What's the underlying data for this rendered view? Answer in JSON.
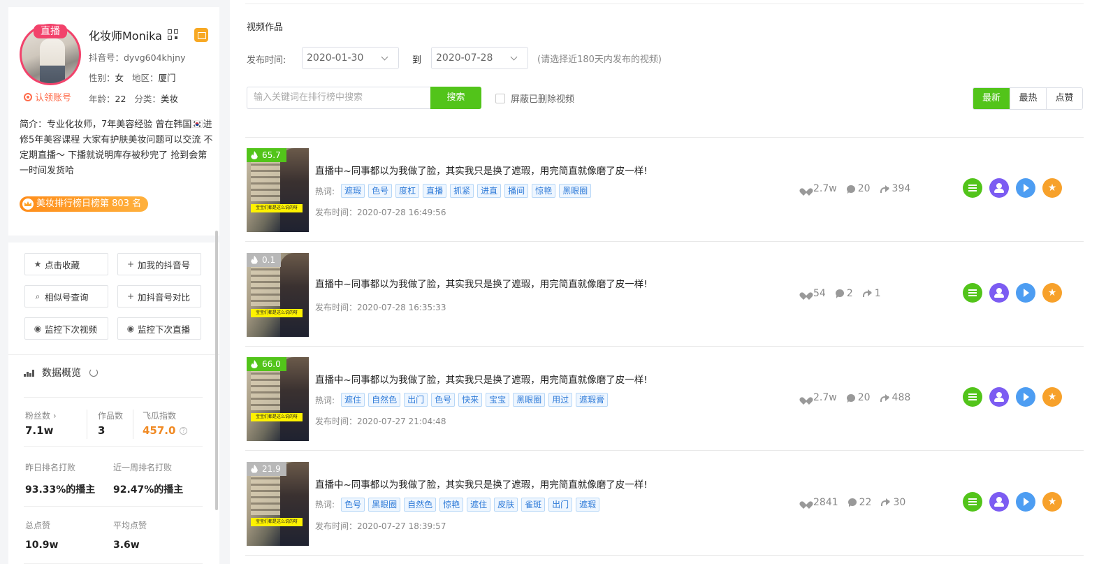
{
  "profile": {
    "live_badge": "直播",
    "name": "化妆师Monika",
    "douyin_id": "抖音号：dyvg604khjny",
    "gender_label": "性别：",
    "gender": "女",
    "region_label": "地区：",
    "region": "厦门",
    "age_label": "年龄：",
    "age": "22",
    "category_label": "分类：",
    "category": "美妆",
    "claim": "认领账号",
    "intro": "简介：专业化妆师，7年美容经验 曾在韩国🇰🇷进修5年美容课程 大家有护肤美妆问题可以交流 不定期直播～ 下播就说明库存被秒完了 抢到会第一时间发货哈",
    "rank": "美妆排行榜日榜第 803 名"
  },
  "actions": {
    "favorite": "点击收藏",
    "add_douyin": "加我的抖音号",
    "similar": "相似号查询",
    "add_compare": "加抖音号对比",
    "monitor_video": "监控下次视频",
    "monitor_live": "监控下次直播"
  },
  "overview": {
    "title": "数据概览",
    "fans_label": "粉丝数 ›",
    "fans": "7.1w",
    "works_label": "作品数",
    "works": "3",
    "feigua_label": "飞瓜指数",
    "feigua": "457.0",
    "yesterday_label": "昨日排名打败",
    "yesterday": "93.33%的播主",
    "week_label": "近一周排名打败",
    "week": "92.47%的播主",
    "likes_label": "总点赞",
    "likes": "10.9w",
    "avg_label": "平均点赞",
    "avg": "3.6w"
  },
  "videos_section": {
    "title": "视频作品",
    "publish_time_label": "发布时间:",
    "date_from": "2020-01-30",
    "to_label": "到",
    "date_to": "2020-07-28",
    "hint": "(请选择近180天内发布的视频)",
    "search_placeholder": "输入关键词在排行榜中搜索",
    "search_button": "搜索",
    "hide_deleted": "屏蔽已删除视频",
    "sort": [
      "最新",
      "最热",
      "点赞"
    ]
  },
  "video_labels": {
    "tags_label": "热词:",
    "caption": "宝宝们都是这么说的呀"
  },
  "videos": [
    {
      "heat": "65.7",
      "title": "直播中~同事都以为我做了脸，其实我只是换了遮瑕，用完简直就像磨了皮一样!",
      "tags": [
        "遮瑕",
        "色号",
        "度杠",
        "直播",
        "抓紧",
        "进直",
        "播间",
        "惊艳",
        "黑眼圈"
      ],
      "pub": "发布时间：2020-07-28 16:49:56",
      "likes": "2.7w",
      "comments": "20",
      "shares": "394"
    },
    {
      "heat": "0.1",
      "title": "直播中~同事都以为我做了脸，其实我只是换了遮瑕，用完简直就像磨了皮一样!",
      "tags": [],
      "pub": "发布时间：2020-07-28 16:35:33",
      "likes": "54",
      "comments": "2",
      "shares": "1"
    },
    {
      "heat": "66.0",
      "title": "直播中~同事都以为我做了脸，其实我只是换了遮瑕，用完简直就像磨了皮一样!",
      "tags": [
        "遮住",
        "自然色",
        "出门",
        "色号",
        "快来",
        "宝宝",
        "黑眼圈",
        "用过",
        "遮瑕膏"
      ],
      "pub": "发布时间：2020-07-27 21:04:48",
      "likes": "2.7w",
      "comments": "20",
      "shares": "488"
    },
    {
      "heat": "21.9",
      "title": "直播中~同事都以为我做了脸，其实我只是换了遮瑕，用完简直就像磨了皮一样!",
      "tags": [
        "色号",
        "黑眼圈",
        "自然色",
        "惊艳",
        "遮住",
        "皮肤",
        "雀斑",
        "出门",
        "遮瑕"
      ],
      "pub": "发布时间：2020-07-27 18:39:57",
      "likes": "2841",
      "comments": "22",
      "shares": "30"
    }
  ],
  "colors": {
    "accent_green": "#52c41a",
    "live_pink": "#f2426b",
    "orange": "#f08a24",
    "tag_blue": "#2f7bd8"
  }
}
